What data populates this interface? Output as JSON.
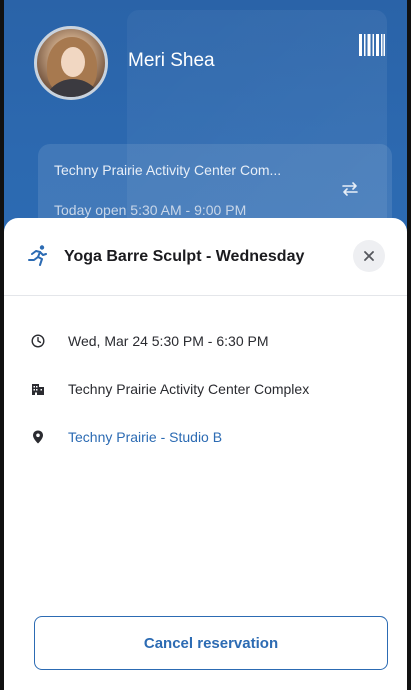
{
  "header": {
    "user_name": "Meri Shea",
    "facility_name": "Techny Prairie Activity Center Com...",
    "facility_hours": "Today open 5:30 AM - 9:00 PM"
  },
  "sheet": {
    "class_title": "Yoga Barre Sculpt - Wednesday",
    "datetime": "Wed, Mar 24 5:30 PM - 6:30 PM",
    "facility": "Techny Prairie Activity Center Complex",
    "location": "Techny Prairie - Studio B",
    "cancel_label": "Cancel reservation"
  },
  "colors": {
    "brand_blue": "#2c6bb3",
    "header_bg": "#2a63a8"
  },
  "icons": {
    "barcode": "barcode-icon",
    "swap": "swap-icon",
    "activity": "running-person-icon",
    "close": "close-icon",
    "clock": "clock-icon",
    "building": "building-icon",
    "pin": "location-pin-icon"
  }
}
